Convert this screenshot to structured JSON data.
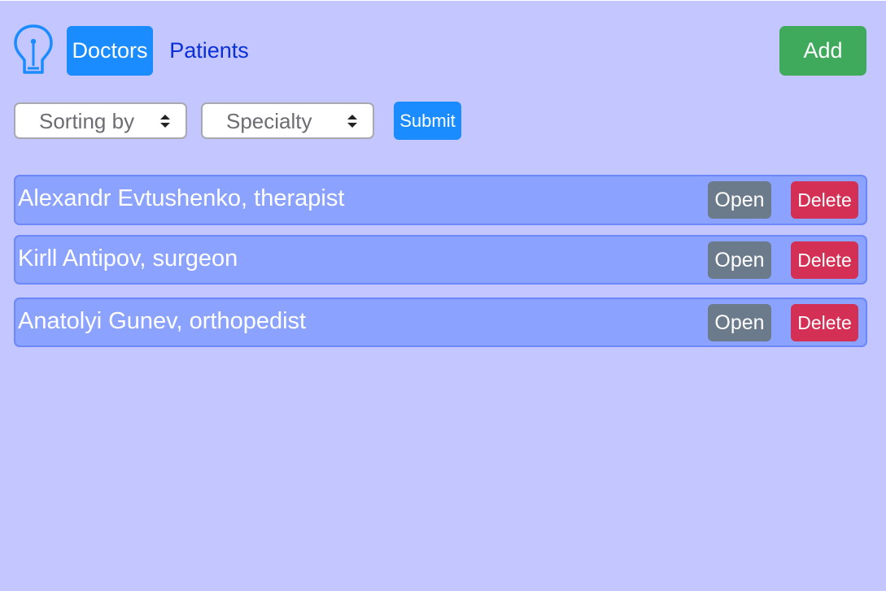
{
  "header": {
    "logo_icon": "lightbulb-icon",
    "nav": {
      "doctors_label": "Doctors",
      "patients_label": "Patients"
    },
    "add_label": "Add"
  },
  "filters": {
    "sort_select": {
      "selected": "Sorting by"
    },
    "specialty_select": {
      "selected": "Specialty"
    },
    "submit_label": "Submit"
  },
  "doctors": [
    {
      "name": "Alexandr Evtushenko, therapist",
      "open_label": "Open",
      "delete_label": "Delete"
    },
    {
      "name": "Kirll Antipov, surgeon",
      "open_label": "Open",
      "delete_label": "Delete"
    },
    {
      "name": "Anatolyi Gunev, orthopedist",
      "open_label": "Open",
      "delete_label": "Delete"
    }
  ],
  "colors": {
    "background": "#c4c6ff",
    "primary": "#1a8cff",
    "success": "#3faa5b",
    "danger": "#d42f55",
    "secondary": "#6c7b8c",
    "row": "#8ba2ff",
    "link": "#0b2fd6"
  }
}
